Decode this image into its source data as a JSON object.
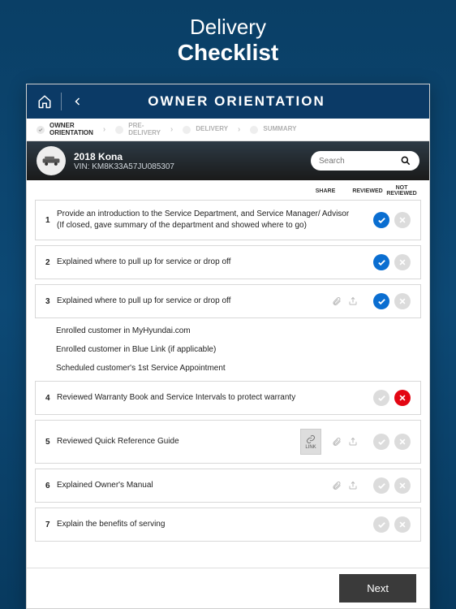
{
  "page": {
    "title_light": "Delivery",
    "title_bold": "Checklist"
  },
  "topbar": {
    "title": "OWNER ORIENTATION"
  },
  "breadcrumbs": [
    {
      "label": "OWNER\nORIENTATION",
      "active": true
    },
    {
      "label": "PRE-\nDELIVERY",
      "active": false
    },
    {
      "label": "DELIVERY",
      "active": false
    },
    {
      "label": "SUMMARY",
      "active": false
    }
  ],
  "vehicle": {
    "title": "2018 Kona",
    "vin_label": "VIN: KM8K33A57JU085307"
  },
  "search": {
    "placeholder": "Search"
  },
  "col_heads": {
    "share": "SHARE",
    "reviewed": "REVIEWED",
    "not_reviewed": "NOT\nREVIEWED"
  },
  "rows": [
    {
      "num": "1",
      "text": "Provide an introduction to the Service Department, and Service Manager/ Advisor (If closed, gave summary of the department and showed where to go)",
      "share": false,
      "reviewed": true,
      "not_reviewed": false
    },
    {
      "num": "2",
      "text": "Explained where to pull up for service or drop off",
      "share": false,
      "reviewed": true,
      "not_reviewed": false
    },
    {
      "num": "3",
      "text": "Explained where to pull up for service or drop off",
      "share": true,
      "reviewed": true,
      "not_reviewed": false,
      "subitems": [
        "Enrolled customer in MyHyundai.com",
        "Enrolled customer in Blue Link (if applicable)",
        "Scheduled customer's 1st Service Appointment"
      ]
    },
    {
      "num": "4",
      "text": "Reviewed Warranty Book and Service Intervals to protect warranty",
      "share": false,
      "reviewed": false,
      "not_reviewed": true
    },
    {
      "num": "5",
      "text": "Reviewed Quick Reference Guide",
      "share": true,
      "link_badge": "LINK",
      "reviewed": false,
      "not_reviewed": false
    },
    {
      "num": "6",
      "text": "Explained Owner's Manual",
      "share": true,
      "reviewed": false,
      "not_reviewed": false
    },
    {
      "num": "7",
      "text": "Explain the benefits of serving",
      "share": false,
      "reviewed": false,
      "not_reviewed": false
    }
  ],
  "footer": {
    "next": "Next"
  }
}
